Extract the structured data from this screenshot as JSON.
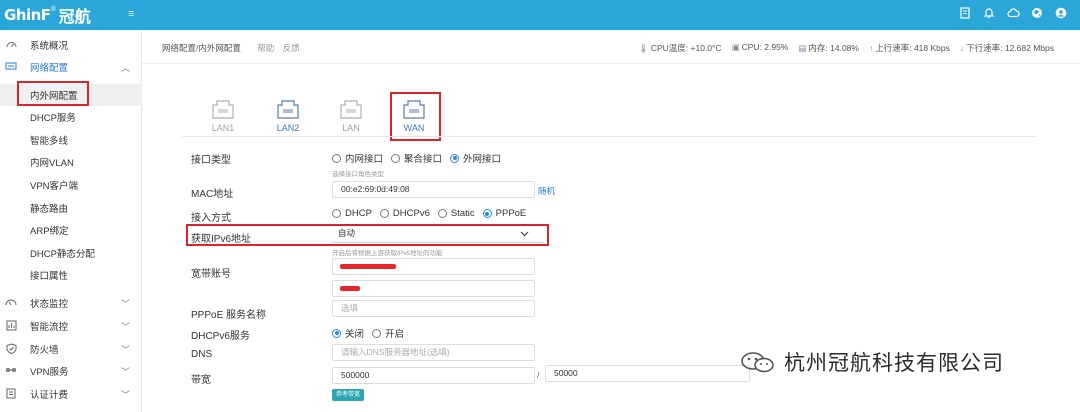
{
  "header": {
    "logo_text": "GhinF",
    "logo_reg": "®",
    "brand": "冠航",
    "menu_glyph": "≡"
  },
  "sidebar": {
    "items": [
      {
        "label": "系统概况",
        "icon": "dashboard-icon"
      },
      {
        "label": "网络配置",
        "icon": "network-icon",
        "expanded": true
      },
      {
        "label": "状态监控",
        "icon": "monitor-icon"
      },
      {
        "label": "智能流控",
        "icon": "flow-icon"
      },
      {
        "label": "防火墙",
        "icon": "shield-icon"
      },
      {
        "label": "VPN服务",
        "icon": "vpn-icon"
      },
      {
        "label": "认证计费",
        "icon": "billing-icon"
      }
    ],
    "subitems": [
      {
        "label": "内外网配置",
        "active": true
      },
      {
        "label": "DHCP服务"
      },
      {
        "label": "智能多线"
      },
      {
        "label": "内网VLAN"
      },
      {
        "label": "VPN客户端"
      },
      {
        "label": "静态路由"
      },
      {
        "label": "ARP绑定"
      },
      {
        "label": "DHCP静态分配"
      },
      {
        "label": "接口属性"
      }
    ]
  },
  "topbar": {
    "breadcrumb": "网络配置/内外网配置",
    "help": "帮助",
    "feedback": "反馈",
    "stats": {
      "cpu_temp": "CPU温度: +10.0°C",
      "cpu": "CPU: 2.95%",
      "memory": "内存: 14.08%",
      "upload": "上行速率: 418 Kbps",
      "download": "下行速率: 12.682 Mbps"
    }
  },
  "ports": [
    {
      "label": "LAN1"
    },
    {
      "label": "LAN2"
    },
    {
      "label": "LAN"
    },
    {
      "label": "WAN"
    }
  ],
  "form": {
    "interface_type": {
      "label": "接口类型",
      "options": [
        "内网接口",
        "聚合接口",
        "外网接口"
      ],
      "selected": "外网接口",
      "hint": "选择接口角色类型"
    },
    "mac": {
      "label": "MAC地址",
      "value": "00:e2:69:0d:49:08",
      "link": "随机"
    },
    "access_mode": {
      "label": "接入方式",
      "options": [
        "DHCP",
        "DHCPv6",
        "Static",
        "PPPoE"
      ],
      "selected": "PPPoE"
    },
    "ipv6": {
      "label": "获取IPv6地址",
      "value": "自动",
      "hint": "开启后将根据上游获取IPv6地址的功能"
    },
    "account": {
      "label": "宽带账号"
    },
    "pppoe_service": {
      "label": "PPPoE 服务名称",
      "placeholder": "选填"
    },
    "dhcpv6": {
      "label": "DHCPv6服务",
      "options": [
        "关闭",
        "开启"
      ],
      "selected": "关闭"
    },
    "dns": {
      "label": "DNS",
      "placeholder": "请输入DNS服务器地址(选填)"
    },
    "bandwidth": {
      "label": "带宽",
      "up": "500000",
      "separator": "/",
      "down": "50000",
      "button": "参考带宽"
    }
  },
  "watermark": {
    "text": "杭州冠航科技有限公司"
  },
  "colors": {
    "header": "#2aa6d9",
    "accent": "#2a8bd6",
    "highlight": "#d9242a"
  }
}
